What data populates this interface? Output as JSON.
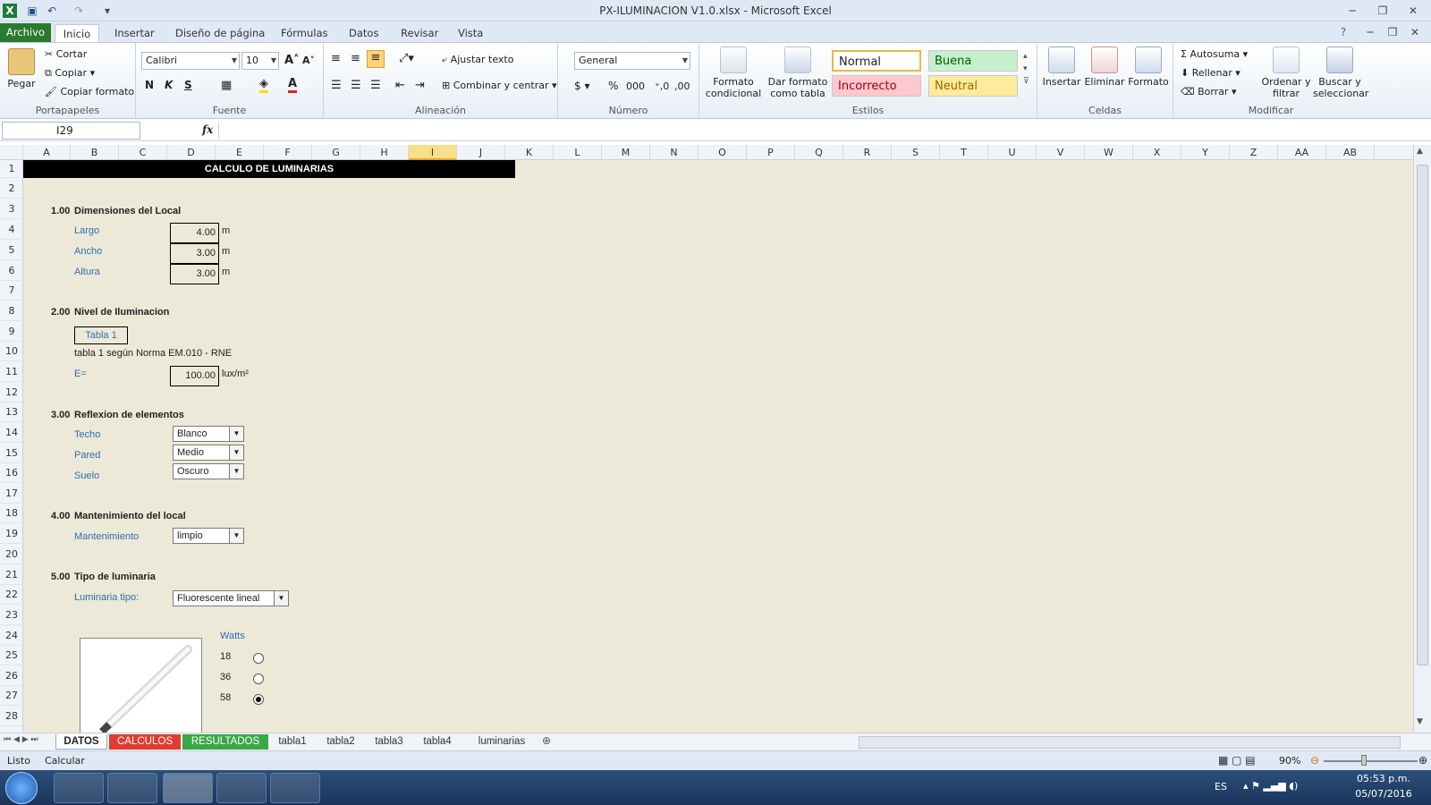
{
  "window": {
    "title": "PX-ILUMINACION V1.0.xlsx  -  Microsoft Excel"
  },
  "tabs": [
    "Archivo",
    "Inicio",
    "Insertar",
    "Diseño de página",
    "Fórmulas",
    "Datos",
    "Revisar",
    "Vista"
  ],
  "ribbon": {
    "clipboard": {
      "paste": "Pegar",
      "cut": "Cortar",
      "copy": "Copiar",
      "format_painter": "Copiar formato",
      "label": "Portapapeles"
    },
    "font": {
      "name": "Calibri",
      "size": "10",
      "bold": "N",
      "italic": "K",
      "underline": "S",
      "label": "Fuente"
    },
    "alignment": {
      "wrap": "Ajustar texto",
      "merge": "Combinar y centrar",
      "label": "Alineación"
    },
    "number": {
      "format": "General",
      "label": "Número"
    },
    "styles": {
      "cond_format": "Formato condicional",
      "table_format": "Dar formato como tabla",
      "normal": "Normal",
      "good": "Buena",
      "bad": "Incorrecto",
      "neutral": "Neutral",
      "label": "Estilos"
    },
    "cells": {
      "insert": "Insertar",
      "delete": "Eliminar",
      "format": "Formato",
      "label": "Celdas"
    },
    "edit": {
      "autosum": "Autosuma",
      "fill": "Rellenar",
      "clear": "Borrar",
      "sort": "Ordenar y filtrar",
      "find": "Buscar y seleccionar",
      "label": "Modificar"
    }
  },
  "formula_bar": {
    "name_box": "I29",
    "fx": "fx",
    "value": ""
  },
  "columns": [
    "A",
    "B",
    "C",
    "D",
    "E",
    "F",
    "G",
    "H",
    "I",
    "J",
    "K",
    "L",
    "M",
    "N",
    "O",
    "P",
    "Q",
    "R",
    "S",
    "T",
    "U",
    "V",
    "W",
    "X",
    "Y",
    "Z",
    "AA",
    "AB"
  ],
  "rows": [
    "1",
    "2",
    "3",
    "4",
    "5",
    "6",
    "7",
    "8",
    "9",
    "10",
    "11",
    "12",
    "13",
    "14",
    "15",
    "16",
    "17",
    "18",
    "19",
    "20",
    "21",
    "22",
    "23",
    "24",
    "25",
    "26",
    "27",
    "28"
  ],
  "sheet": {
    "header": "CALCULO DE LUMINARIAS",
    "s1": {
      "num": "1.00",
      "title": "Dimensiones del Local",
      "largo": "Largo",
      "largo_v": "4.00",
      "ancho": "Ancho",
      "ancho_v": "3.00",
      "altura": "Altura",
      "altura_v": "3.00",
      "unit": "m"
    },
    "s2": {
      "num": "2.00",
      "title": "Nivel de Iluminacion",
      "button": "Tabla 1",
      "note": "tabla 1 según Norma EM.010 - RNE",
      "e_label": "E=",
      "e_value": "100.00",
      "e_unit": "lux/m²"
    },
    "s3": {
      "num": "3.00",
      "title": "Reflexion de elementos",
      "techo": "Techo",
      "techo_v": "Blanco",
      "pared": "Pared",
      "pared_v": "Medio",
      "suelo": "Suelo",
      "suelo_v": "Oscuro"
    },
    "s4": {
      "num": "4.00",
      "title": "Mantenimiento del local",
      "mant": "Mantenimiento",
      "mant_v": "limpio"
    },
    "s5": {
      "num": "5.00",
      "title": "Tipo de luminaria",
      "tipo": "Luminaria tipo:",
      "tipo_v": "Fluorescente lineal",
      "watts": "Watts",
      "w1": "18",
      "w2": "36",
      "w3": "58",
      "selected_watts": "58"
    }
  },
  "sheet_tabs": [
    {
      "name": "DATOS",
      "color": "#ffffff",
      "active": true
    },
    {
      "name": "CALCULOS",
      "color": "#e03c31"
    },
    {
      "name": "RESULTADOS",
      "color": "#3aa845"
    },
    {
      "name": "tabla1"
    },
    {
      "name": "tabla2"
    },
    {
      "name": "tabla3"
    },
    {
      "name": "tabla4"
    },
    {
      "name": "luminarias"
    }
  ],
  "status": {
    "ready": "Listo",
    "calc": "Calcular",
    "zoom": "90%"
  },
  "taskbar": {
    "lang": "ES",
    "time": "05:53 p.m.",
    "date": "05/07/2016"
  }
}
